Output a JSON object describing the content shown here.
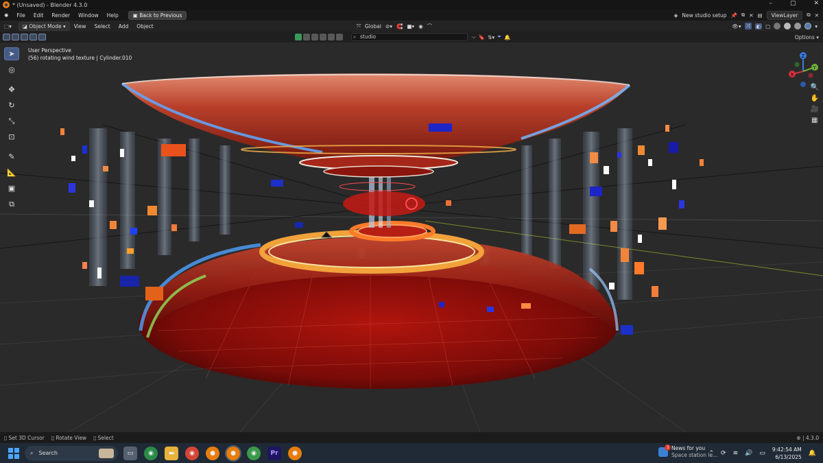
{
  "window": {
    "title": "* (Unsaved) - Blender 4.3.0",
    "controls": [
      "–",
      "▢",
      "✕"
    ]
  },
  "menubar": {
    "items": [
      "File",
      "Edit",
      "Render",
      "Window",
      "Help"
    ],
    "back_button": "Back to Previous",
    "scene_name": "New studio setup",
    "view_layer": "ViewLayer"
  },
  "header": {
    "mode": "Object Mode",
    "menus": [
      "View",
      "Select",
      "Add",
      "Object"
    ],
    "transform_orientation": "Global"
  },
  "subheader": {
    "search_value": "studio",
    "options_label": "Options"
  },
  "viewport": {
    "perspective_label": "User Perspective",
    "object_info": "(56) rotating wind texture | Cylinder.010"
  },
  "toolbar": {
    "tools": [
      {
        "name": "select-box-tool",
        "glyph": "➤",
        "active": true
      },
      {
        "name": "cursor-tool",
        "glyph": "◎"
      },
      {
        "name": "move-tool",
        "glyph": "✥"
      },
      {
        "name": "rotate-tool",
        "glyph": "↻"
      },
      {
        "name": "scale-tool",
        "glyph": "⤡"
      },
      {
        "name": "transform-tool",
        "glyph": "⊡"
      },
      {
        "name": "annotate-tool",
        "glyph": "✎"
      },
      {
        "name": "measure-tool",
        "glyph": "📐"
      },
      {
        "name": "add-cube-tool",
        "glyph": "▣"
      },
      {
        "name": "extrude-tool",
        "glyph": "⧉"
      }
    ]
  },
  "gizmo": {
    "axis_z": "Z",
    "axis_y": "Y",
    "axis_x": "X",
    "nav_icons": [
      "zoom-icon",
      "hand-pan-icon",
      "camera-icon",
      "grid-view-icon"
    ]
  },
  "statusbar": {
    "hints": [
      "Set 3D Cursor",
      "Rotate View",
      "Select"
    ],
    "version": "4.3.0"
  },
  "taskbar": {
    "search_placeholder": "Search",
    "news_badge": "3",
    "news_title": "News for you",
    "news_subtitle": "Space station le...",
    "time": "9:42:54 AM",
    "date": "6/13/2025"
  },
  "colors": {
    "accent": "#445b86",
    "blender_orange": "#e87d0d",
    "taskbar_bg": "#202a36"
  }
}
